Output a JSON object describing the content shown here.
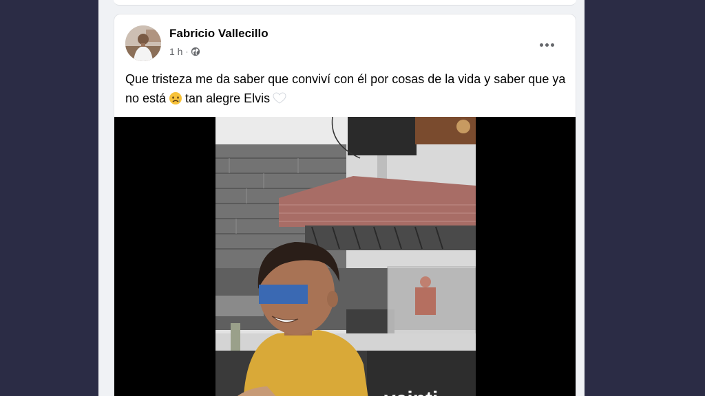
{
  "post": {
    "author": "Fabricio Vallecillo",
    "time": "1 h",
    "meta_separator": "·",
    "privacy_icon": "globe-icon",
    "more_icon": "more-horizontal-icon",
    "text_part1": "Que tristeza me da saber que conviví con él por cosas de la vida y saber que ya no está",
    "emoji1": "disappointed-relieved-face",
    "text_part2": "tan alegre Elvis",
    "emoji2": "white-heart"
  },
  "media": {
    "sign_text": "veinti"
  },
  "colors": {
    "page_background": "#2b2c45",
    "feed_background": "#f0f2f5",
    "card": "#ffffff",
    "text_primary": "#050505",
    "text_secondary": "#65676b",
    "censor_bar": "#3a69b3"
  }
}
